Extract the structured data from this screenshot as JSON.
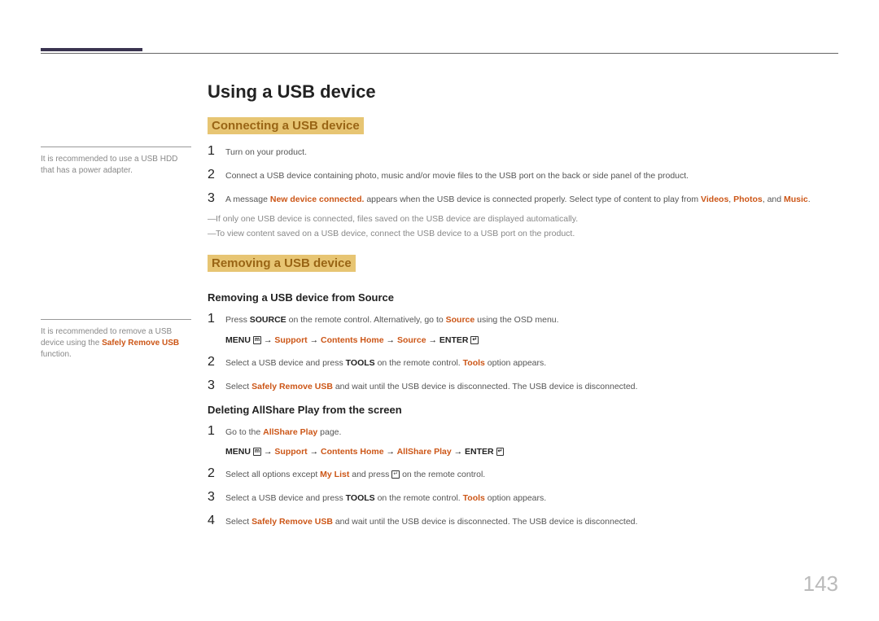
{
  "pageNumber": "143",
  "title": "Using a USB device",
  "sidenotes": {
    "note1_a": "It is recommended to use a USB HDD that has a power adapter.",
    "note2_a": "It is recommended to remove a USB device using the ",
    "note2_b": "Safely Remove USB",
    "note2_c": " function."
  },
  "section1": {
    "heading": "Connecting a USB device",
    "steps": {
      "s1": "Turn on your product.",
      "s2": "Connect a USB device containing photo, music and/or movie files to the USB port on the back or side panel of the product.",
      "s3_a": "A message ",
      "s3_b": "New device connected.",
      "s3_c": " appears when the USB device is connected properly. Select type of content to play from ",
      "s3_d": "Videos",
      "s3_e": "Photos",
      "s3_f": "Music"
    },
    "notes": {
      "n1": "If only one USB device is connected, files saved on the USB device are displayed automatically.",
      "n2": "To view content saved on a USB device, connect the USB device to a USB port on the product."
    }
  },
  "section2": {
    "heading": "Removing a USB device",
    "sub1": {
      "heading": "Removing a USB device from Source",
      "s1_a": "Press ",
      "s1_b": "SOURCE",
      "s1_c": " on the remote control. Alternatively, go to ",
      "s1_d": "Source",
      "s1_e": " using the OSD menu.",
      "nav_menu": "MENU",
      "nav_support": "Support",
      "nav_contents": "Contents Home",
      "nav_source": "Source",
      "nav_enter": "ENTER",
      "s2_a": "Select a USB device and press ",
      "s2_b": "TOOLS",
      "s2_c": " on the remote control. ",
      "s2_d": "Tools",
      "s2_e": " option appears.",
      "s3_a": "Select ",
      "s3_b": "Safely Remove USB",
      "s3_c": " and wait until the USB device is disconnected. The USB device is disconnected."
    },
    "sub2": {
      "heading": "Deleting AllShare Play from the screen",
      "s1_a": "Go to the ",
      "s1_b": "AllShare Play",
      "s1_c": " page.",
      "nav_menu": "MENU",
      "nav_support": "Support",
      "nav_contents": "Contents Home",
      "nav_allshare": "AllShare Play",
      "nav_enter": "ENTER",
      "s2_a": "Select all options except ",
      "s2_b": "My List",
      "s2_c": " and press ",
      "s2_d": " on the remote control.",
      "s3_a": "Select a USB device and press ",
      "s3_b": "TOOLS",
      "s3_c": " on the remote control. ",
      "s3_d": "Tools",
      "s3_e": " option appears.",
      "s4_a": "Select ",
      "s4_b": "Safely Remove USB",
      "s4_c": " and wait until the USB device is disconnected. The USB device is disconnected."
    }
  },
  "glyphs": {
    "arrow": "→",
    "menuIcon": "m",
    "enterIcon": "↵"
  },
  "nums": {
    "n1": "1",
    "n2": "2",
    "n3": "3",
    "n4": "4"
  }
}
